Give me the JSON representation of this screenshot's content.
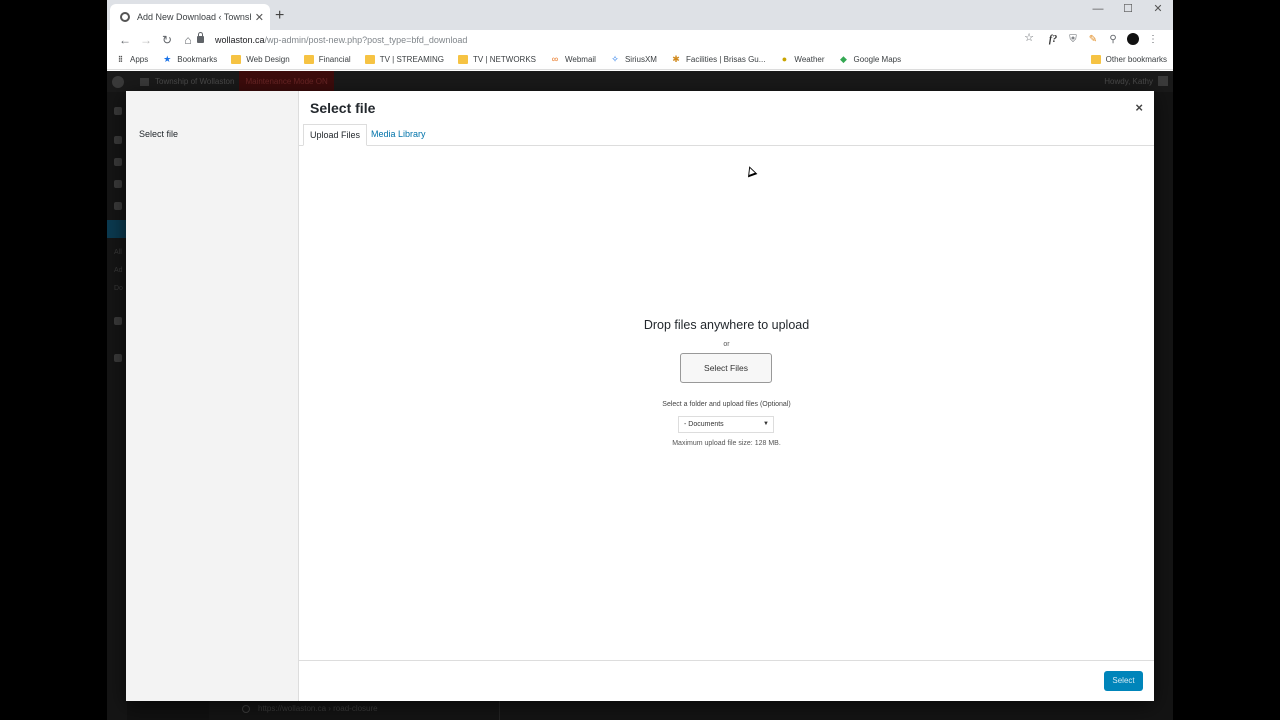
{
  "browser": {
    "tab_title": "Add New Download ‹ Township o",
    "new_tab": "+",
    "url_host": "wollaston.ca",
    "url_path": "/wp-admin/post-new.php?post_type=bfd_download",
    "window_controls": [
      "—",
      "☐",
      "✕"
    ]
  },
  "bookmarks": {
    "items": [
      {
        "label": "Apps",
        "icon": "apps-icon"
      },
      {
        "label": "Bookmarks",
        "icon": "star-icon"
      },
      {
        "label": "Web Design",
        "icon": "folder-icon"
      },
      {
        "label": "Financial",
        "icon": "folder-icon"
      },
      {
        "label": "TV | STREAMING",
        "icon": "folder-icon"
      },
      {
        "label": "TV | NETWORKS",
        "icon": "folder-icon"
      },
      {
        "label": "Webmail",
        "icon": "webmail-icon"
      },
      {
        "label": "SiriusXM",
        "icon": "siriusxm-icon"
      },
      {
        "label": "Facilities | Brisas Gu...",
        "icon": "facilities-icon"
      },
      {
        "label": "Weather",
        "icon": "weather-icon"
      },
      {
        "label": "Google Maps",
        "icon": "maps-icon"
      }
    ],
    "other": "Other bookmarks"
  },
  "adminbar": {
    "site": "Township of Wollaston",
    "maintenance": "Maintenance Mode ON",
    "howdy": "Howdy, Kathy"
  },
  "background": {
    "menu_labels": [
      "All",
      "Ad",
      "Do"
    ],
    "status_url": "https://wollaston.ca › road-closure"
  },
  "modal": {
    "menu_item": "Select file",
    "title": "Select file",
    "close": "×",
    "tabs": {
      "upload": "Upload Files",
      "library": "Media Library"
    },
    "drop_text": "Drop files anywhere to upload",
    "or_text": "or",
    "select_files": "Select Files",
    "folder_label": "Select a folder and upload files (Optional)",
    "folder_value": "- Documents",
    "max_size": "Maximum upload file size: 128 MB.",
    "select_button": "Select"
  },
  "colors": {
    "accent": "#0085ba",
    "link": "#0073aa",
    "maintenance_bg": "#3d0c0c"
  }
}
